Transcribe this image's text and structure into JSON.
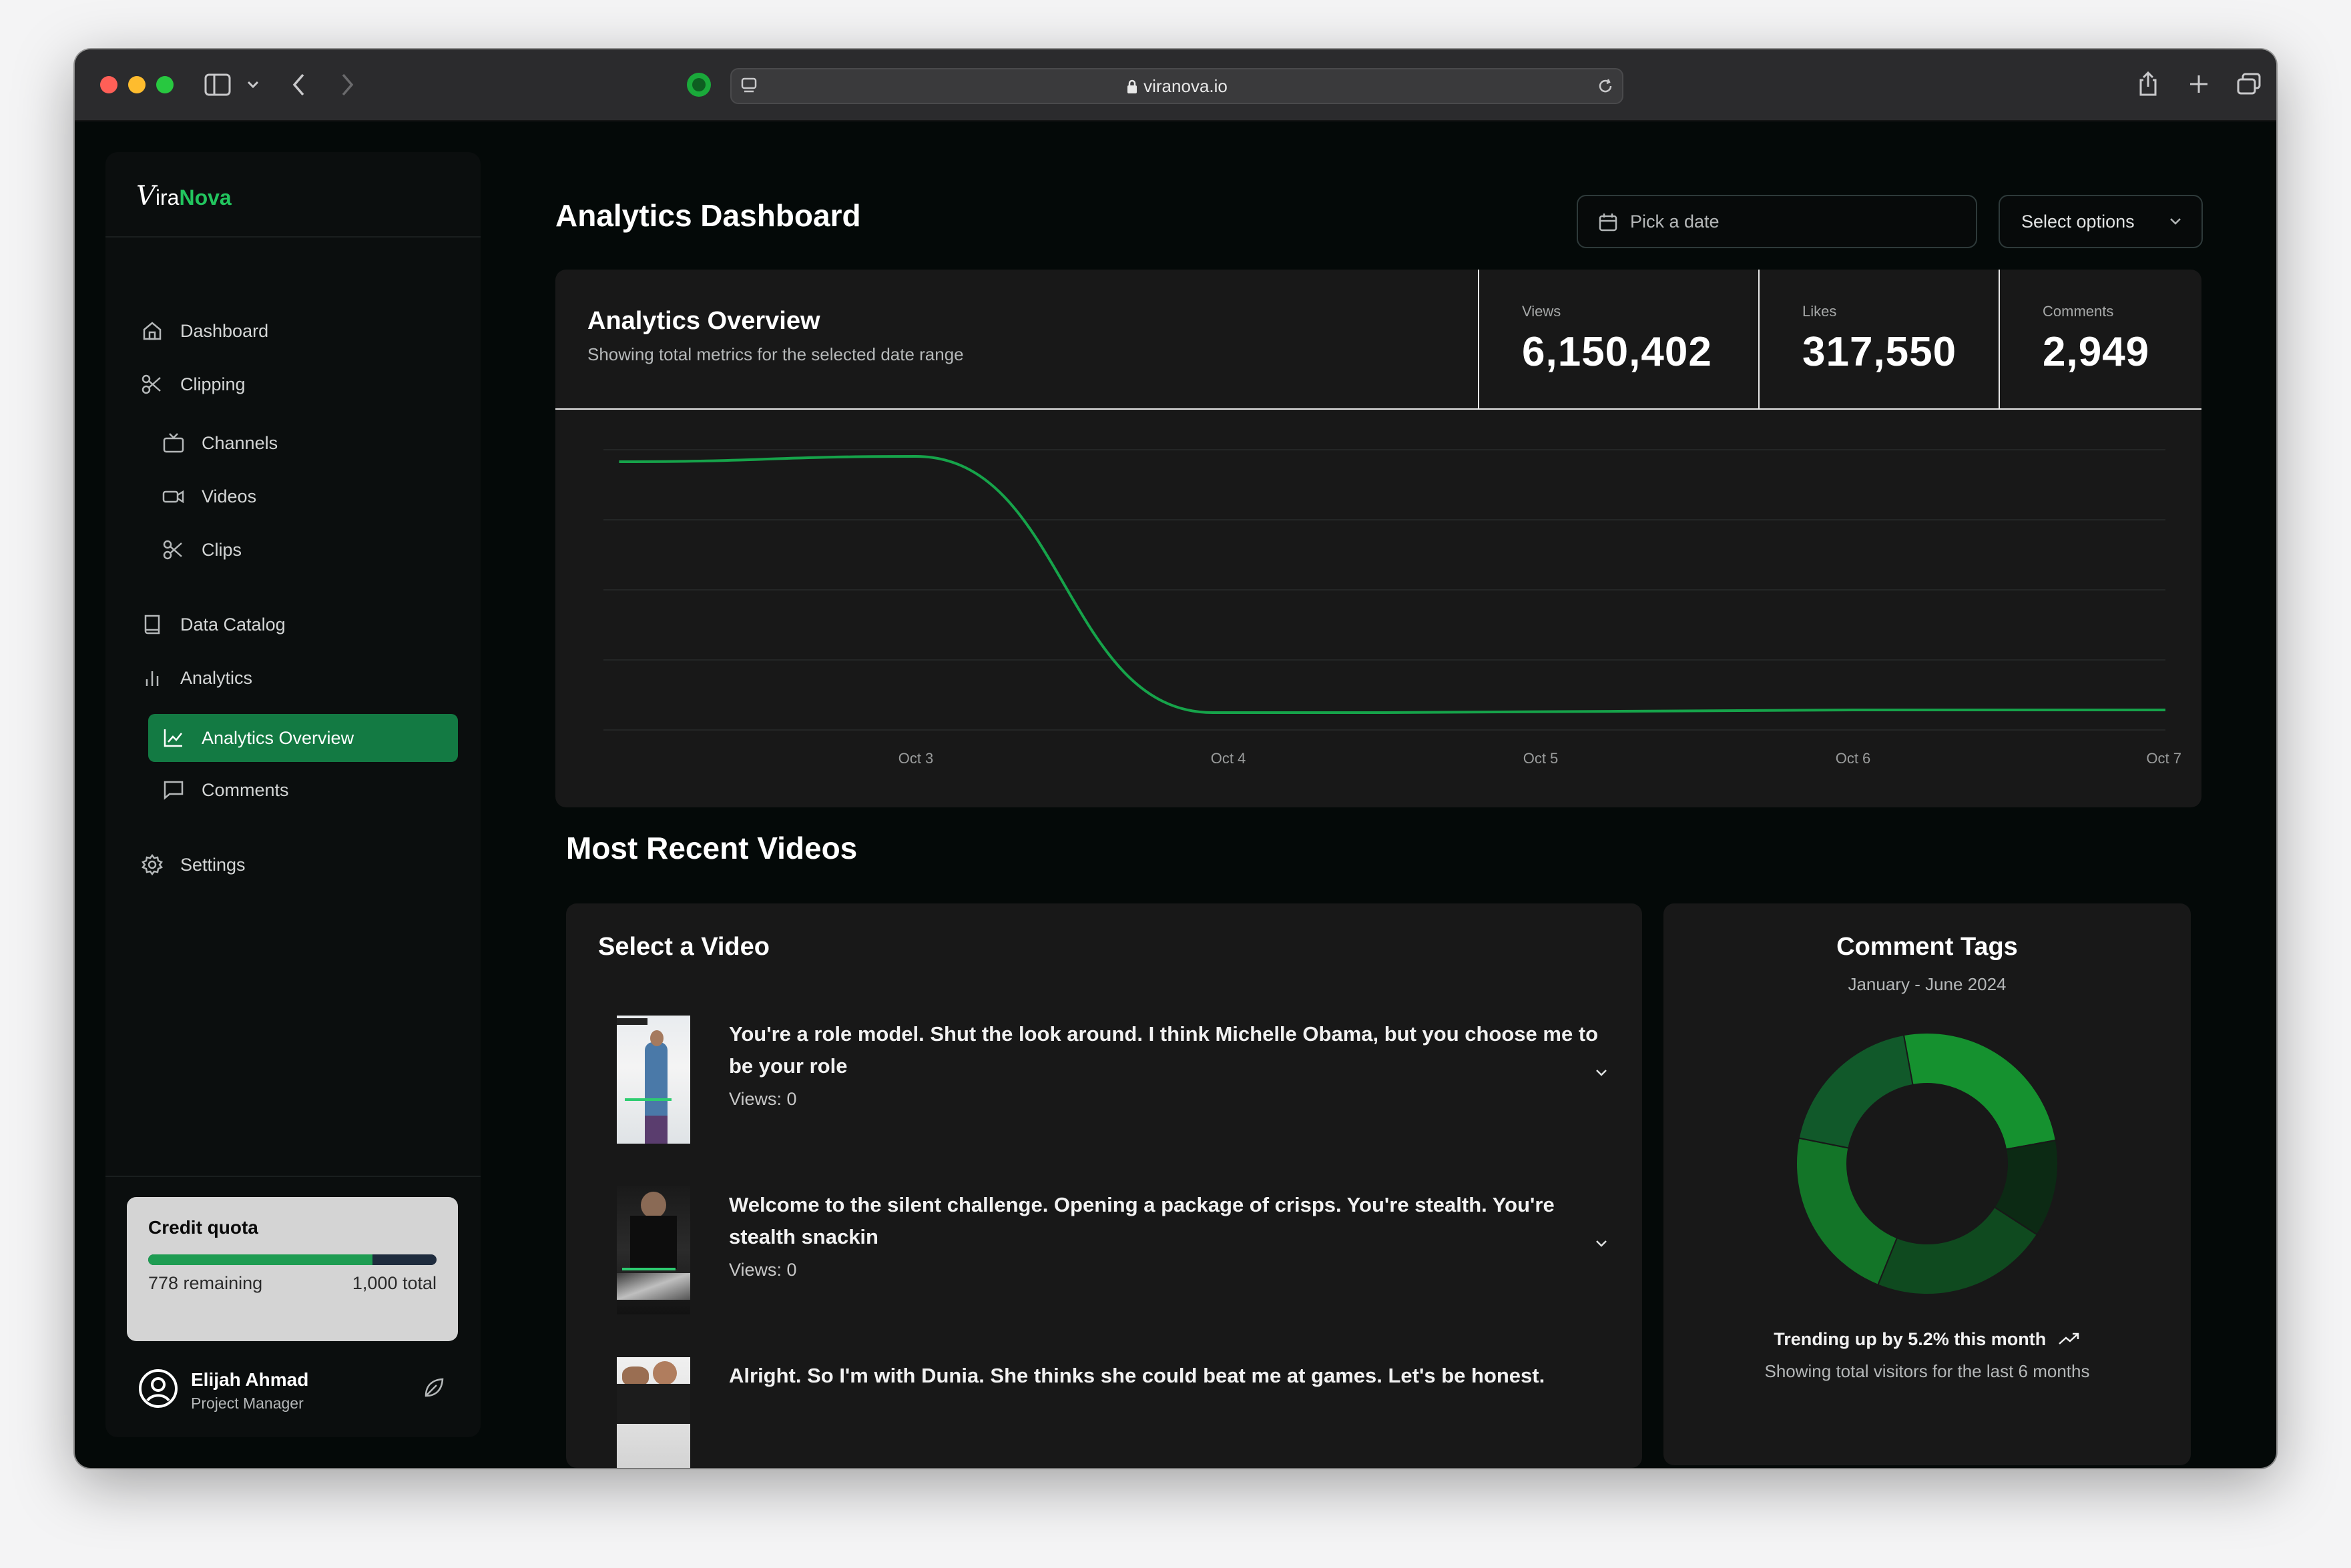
{
  "browser": {
    "url": "viranova.io"
  },
  "brand": {
    "logo_v": "V",
    "logo_prefix": "ira",
    "logo_accent": "Nova",
    "accent_color": "#22c55e"
  },
  "sidebar": {
    "items": [
      {
        "label": "Dashboard",
        "icon": "home-icon"
      },
      {
        "label": "Clipping",
        "icon": "scissors-icon"
      },
      {
        "label": "Channels",
        "icon": "tv-icon"
      },
      {
        "label": "Videos",
        "icon": "video-icon"
      },
      {
        "label": "Clips",
        "icon": "scissors-icon"
      },
      {
        "label": "Data Catalog",
        "icon": "book-icon"
      },
      {
        "label": "Analytics",
        "icon": "bar-chart-icon"
      },
      {
        "label": "Analytics Overview",
        "icon": "line-chart-icon",
        "active": true
      },
      {
        "label": "Comments",
        "icon": "message-square-icon"
      },
      {
        "label": "Settings",
        "icon": "gear-icon"
      }
    ],
    "credit": {
      "title": "Credit quota",
      "remaining": "778 remaining",
      "total": "1,000 total",
      "used_fraction": 0.778
    },
    "user": {
      "name": "Elijah Ahmad",
      "role": "Project Manager"
    }
  },
  "header": {
    "title": "Analytics Dashboard",
    "date_placeholder": "Pick a date",
    "select_label": "Select options"
  },
  "overview": {
    "title": "Analytics Overview",
    "subtitle": "Showing total metrics for the selected date range",
    "stats": [
      {
        "label": "Views",
        "value": "6,150,402"
      },
      {
        "label": "Likes",
        "value": "317,550"
      },
      {
        "label": "Comments",
        "value": "2,949"
      }
    ]
  },
  "chart_data": {
    "type": "line",
    "x": [
      "Oct 3",
      "Oct 4",
      "Oct 5",
      "Oct 6",
      "Oct 7"
    ],
    "series": [
      {
        "color": "#16a34a",
        "points": [
          [
            2.05,
            0.98
          ],
          [
            3.0,
            1.0
          ],
          [
            3.95,
            0.04
          ],
          [
            4.5,
            0.04
          ],
          [
            6.0,
            0.05
          ],
          [
            7.0,
            0.05
          ]
        ]
      }
    ],
    "ylim": [
      0,
      1.05
    ],
    "grid": true
  },
  "recent": {
    "title": "Most Recent Videos",
    "select_title": "Select a Video",
    "videos": [
      {
        "title": "You're a role model. Shut the look around. I think Michelle Obama, but you choose me to be your role",
        "views": "Views: 0"
      },
      {
        "title": "Welcome to the silent challenge. Opening a package of crisps. You're stealth. You're stealth snackin",
        "views": "Views: 0"
      },
      {
        "title": "Alright. So I'm with Dunia. She thinks she could beat me at games. Let's be honest.",
        "views": ""
      }
    ]
  },
  "tags": {
    "title": "Comment Tags",
    "subtitle": "January - June 2024",
    "trend": "Trending up by 5.2% this month",
    "footer": "Showing total visitors for the last 6 months",
    "slices": [
      {
        "value": 25,
        "color": "#15912f"
      },
      {
        "value": 12,
        "color": "#0c2a14"
      },
      {
        "value": 22,
        "color": "#0f4a1f"
      },
      {
        "value": 22,
        "color": "#137528"
      },
      {
        "value": 19,
        "color": "#11592a"
      }
    ]
  }
}
